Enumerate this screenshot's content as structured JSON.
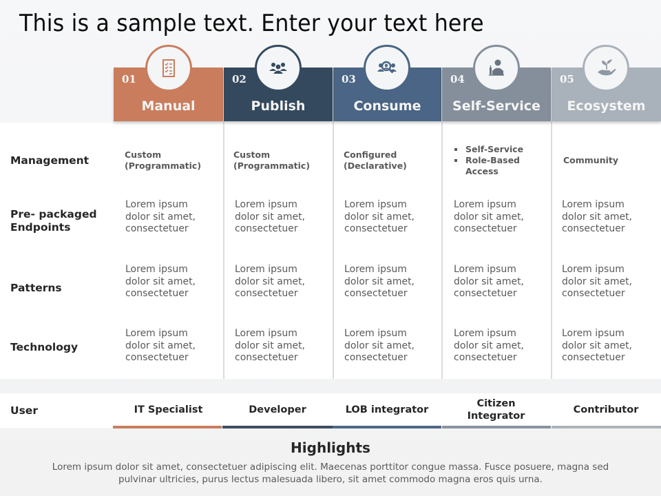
{
  "title": "This is a sample text. Enter your text here",
  "colors": {
    "manual": "#c97d5d",
    "publish": "#34495e",
    "consume": "#4a6585",
    "self_service": "#858f9b",
    "ecosystem": "#a9b1ba"
  },
  "columns": [
    {
      "number": "01",
      "label": "Manual",
      "icon": "checklist-icon",
      "user": "IT Specialist"
    },
    {
      "number": "02",
      "label": "Publish",
      "icon": "people-group-icon",
      "user": "Developer"
    },
    {
      "number": "03",
      "label": "Consume",
      "icon": "user-search-icon",
      "user": "LOB integrator"
    },
    {
      "number": "04",
      "label": "Self-Service",
      "icon": "waiter-icon",
      "user": "Citizen Integrator"
    },
    {
      "number": "05",
      "label": "Ecosystem",
      "icon": "hand-plant-icon",
      "user": "Contributor"
    }
  ],
  "rows": [
    {
      "label": "Management",
      "cells": [
        {
          "line1": "Custom",
          "line2": "(Programmatic)"
        },
        {
          "line1": "Custom",
          "line2": "(Programmatic)"
        },
        {
          "line1": "Configured",
          "line2": "(Declarative)"
        },
        {
          "bullets": [
            "Self-Service",
            "Role-Based",
            "Access"
          ]
        },
        {
          "line1": "Community",
          "line2": ""
        }
      ]
    },
    {
      "label_line1": "Pre- packaged",
      "label_line2": "Endpoints",
      "cells": [
        "Lorem ipsum",
        "dolor sit amet,",
        "consectetuer"
      ]
    },
    {
      "label": "Patterns",
      "cells": [
        "Lorem ipsum",
        "dolor sit amet,",
        "consectetuer"
      ]
    },
    {
      "label": "Technology",
      "cells": [
        "Lorem ipsum",
        "dolor sit amet,",
        "consectetuer"
      ]
    }
  ],
  "user_row": {
    "label": "User",
    "citizen_line1": "Citizen",
    "citizen_line2": "Integrator"
  },
  "highlights": {
    "title": "Highlights",
    "line1": "Lorem ipsum dolor sit amet, consectetuer adipiscing elit. Maecenas porttitor congue massa. Fusce posuere, magna sed",
    "line2": "pulvinar ultricies, purus lectus malesuada libero, sit amet commodo magna eros quis urna."
  }
}
